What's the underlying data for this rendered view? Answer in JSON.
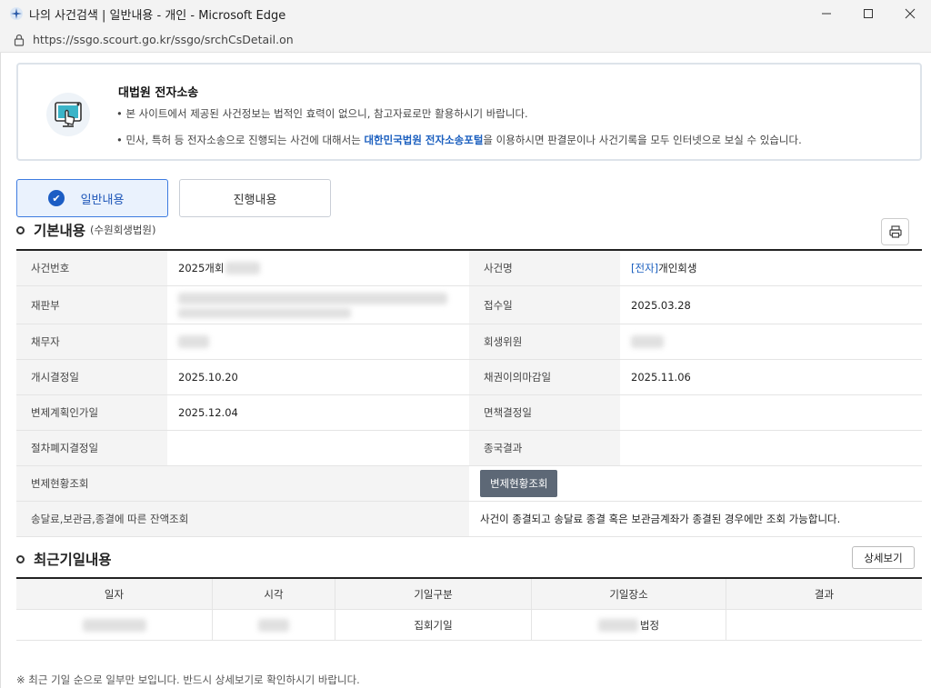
{
  "window": {
    "title": "나의 사건검색 | 일반내용 - 개인 - Microsoft Edge",
    "url": "https://ssgo.scourt.go.kr/ssgo/srchCsDetail.on",
    "controls": {
      "minimize": "—",
      "maximize": "☐",
      "close": "✕"
    }
  },
  "notice": {
    "title": "대법원 전자소송",
    "line1": "• 본 사이트에서 제공된 사건정보는 법적인 효력이 없으니, 참고자료로만 활용하시기 바랍니다.",
    "line2_pre": "• 민사, 특허 등 전자소송으로 진행되는 사건에 대해서는 ",
    "line2_link": "대한민국법원 전자소송포털",
    "line2_post": "을 이용하시면 판결문이나 사건기록을 모두 인터넷으로 보실 수 있습니다."
  },
  "tabs": {
    "general": "일반내용",
    "progress": "진행내용"
  },
  "basic": {
    "title": "기본내용",
    "court": "(수원회생법원)",
    "rows": [
      {
        "l1": "사건번호",
        "v1": "2025개회",
        "l2": "사건명",
        "v2_link": "[전자]",
        "v2": "개인회생"
      },
      {
        "l1": "재판부",
        "v1": "",
        "l2": "접수일",
        "v2": "2025.03.28"
      },
      {
        "l1": "채무자",
        "v1": "",
        "l2": "회생위원",
        "v2": ""
      },
      {
        "l1": "개시결정일",
        "v1": "2025.10.20",
        "l2": "채권이의마감일",
        "v2": "2025.11.06"
      },
      {
        "l1": "변제계획인가일",
        "v1": "2025.12.04",
        "l2": "면책결정일",
        "v2": ""
      },
      {
        "l1": "절차폐지결정일",
        "v1": "",
        "l2": "종국결과",
        "v2": ""
      }
    ],
    "repay_label": "변제현황조회",
    "repay_button": "변제현황조회",
    "balance_label": "송달료,보관금,종결에 따른 잔액조회",
    "balance_text": "사건이 종결되고 송달료 종결 혹은 보관금계좌가 종결된 경우에만 조회 가능합니다."
  },
  "recent": {
    "title": "최근기일내용",
    "detail_button": "상세보기",
    "headers": [
      "일자",
      "시각",
      "기일구분",
      "기일장소",
      "결과"
    ],
    "row": {
      "type": "집회기일",
      "place_suffix": "법정",
      "result": ""
    },
    "footnote": "※ 최근 기일 순으로 일부만 보입니다. 반드시 상세보기로 확인하시기 바랍니다."
  }
}
